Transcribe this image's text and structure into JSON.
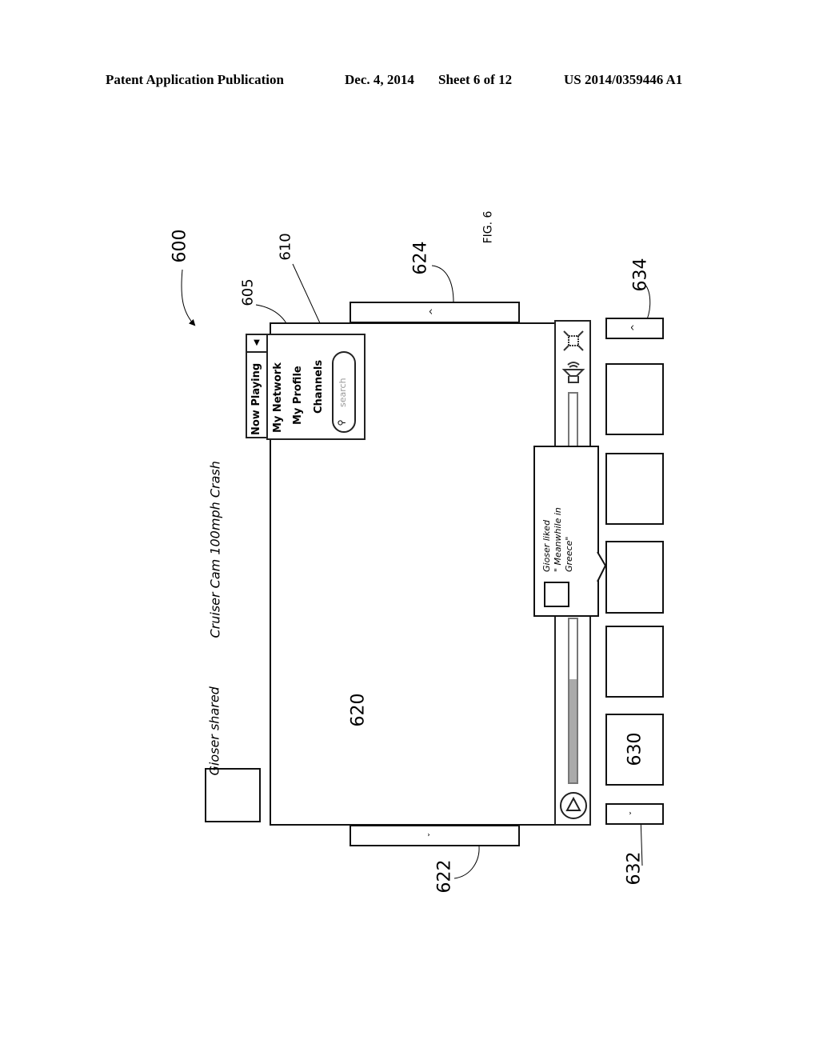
{
  "header": {
    "publication": "Patent Application Publication",
    "date": "Dec. 4, 2014",
    "sheet": "Sheet 6 of 12",
    "patent_number": "US 2014/0359446 A1"
  },
  "figure": {
    "label": "FIG. 6",
    "refs": {
      "r600": "600",
      "r605": "605",
      "r610": "610",
      "r620": "620",
      "r622": "622",
      "r624": "624",
      "r630": "630",
      "r632": "632",
      "r634": "634"
    }
  },
  "share_banner": {
    "actor": "Gioser shared",
    "title": "Cruiser Cam 100mph Crash"
  },
  "menu": {
    "selected": "Now Playing",
    "dropdown_icon": "triangle-down-icon",
    "items": [
      "My Network",
      "My Profile",
      "Channels"
    ],
    "search_placeholder": "search"
  },
  "player": {
    "progress_fraction": 0.63,
    "icons": [
      "play-icon",
      "volume-icon",
      "fullscreen-icon"
    ]
  },
  "notification": {
    "line1": "Gioser liked",
    "line2": "\" Meanwhile in",
    "line3": "Greece\""
  },
  "buttons": {
    "scroll_up": "^",
    "scroll_down": "ˇ",
    "thumb_up": "^",
    "thumb_down": "ˇ"
  }
}
